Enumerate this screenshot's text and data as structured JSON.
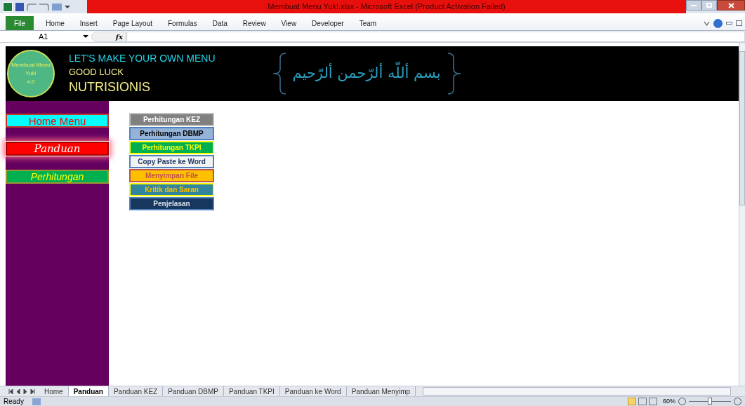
{
  "window": {
    "title": "Membuat Menu Yuk!.xlsx  -  Microsoft Excel (Product Activation Failed)"
  },
  "ribbon_tabs": [
    {
      "label": "File",
      "kind": "file",
      "selected": false
    },
    {
      "label": "Home",
      "kind": "tab",
      "selected": false
    },
    {
      "label": "Insert",
      "kind": "tab",
      "selected": false
    },
    {
      "label": "Page Layout",
      "kind": "tab",
      "selected": false
    },
    {
      "label": "Formulas",
      "kind": "tab",
      "selected": false
    },
    {
      "label": "Data",
      "kind": "tab",
      "selected": false
    },
    {
      "label": "Review",
      "kind": "tab",
      "selected": false
    },
    {
      "label": "View",
      "kind": "tab",
      "selected": false
    },
    {
      "label": "Developer",
      "kind": "tab",
      "selected": false
    },
    {
      "label": "Team",
      "kind": "tab",
      "selected": false
    }
  ],
  "formula_bar": {
    "name_box": "A1",
    "fx": "fx"
  },
  "banner": {
    "logo": [
      "Membuat Menu",
      "Yuk!",
      "4.0"
    ],
    "lines": [
      "LET'S MAKE YOUR OWN MENU",
      "GOOD LUCK",
      "NUTRISIONIS"
    ],
    "arabic": "بسم أللّه ألرّحمن ألرّحيم"
  },
  "sidebar": {
    "items": [
      {
        "label": "Home Menu",
        "kind": "home",
        "selected": false
      },
      {
        "label": "Panduan",
        "kind": "panduan",
        "selected": true
      },
      {
        "label": "Perhitungan",
        "kind": "perhitungan",
        "selected": false
      }
    ]
  },
  "menu_buttons": [
    {
      "label": "Perhitungan  KEZ",
      "color": "#808080"
    },
    {
      "label": "Perhitungan  DBMP",
      "color": "#95b3d7"
    },
    {
      "label": "Perhitungan  TKPI",
      "color": "#00b050"
    },
    {
      "label": "Copy Paste ke Word",
      "color": "#f2f2f2"
    },
    {
      "label": "Menyimpan File",
      "color": "#ffc000"
    },
    {
      "label": "Kritik dan Saran",
      "color": "#31859c"
    },
    {
      "label": "Penjelasan",
      "color": "#17375e"
    }
  ],
  "sheet_tabs": [
    {
      "label": "Home",
      "selected": false
    },
    {
      "label": "Panduan",
      "selected": true
    },
    {
      "label": "Panduan KEZ",
      "selected": false
    },
    {
      "label": "Panduan DBMP",
      "selected": false
    },
    {
      "label": "Panduan TKPI",
      "selected": false
    },
    {
      "label": "Panduan ke Word",
      "selected": false
    },
    {
      "label": "Panduan Menyimp",
      "selected": false
    }
  ],
  "status_bar": {
    "status": "Ready",
    "zoom": "60%",
    "zoom_slider": {
      "level": 0.5
    }
  }
}
